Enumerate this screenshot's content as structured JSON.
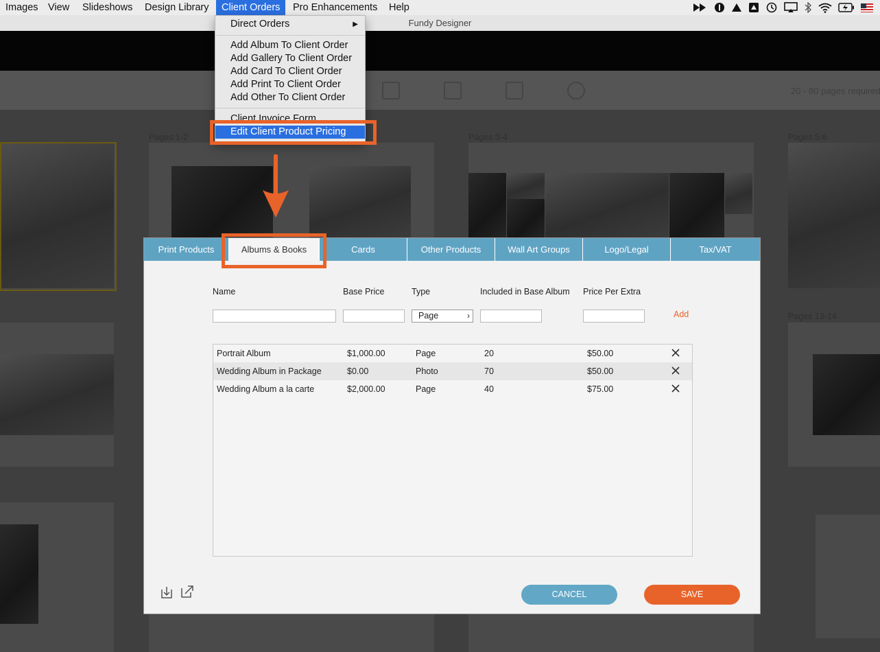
{
  "menubar": {
    "items": [
      "Images",
      "View",
      "Slideshows",
      "Design Library",
      "Client Orders",
      "Pro Enhancements",
      "Help"
    ],
    "active_index": 4
  },
  "app": {
    "title": "Fundy Designer"
  },
  "toolbar": {
    "pages_note": "20 - 80 pages required"
  },
  "spreads": {
    "labels": [
      "Pages 1-2",
      "Pages 3-4",
      "Pages 5-6",
      "Pages 13-14"
    ]
  },
  "client_orders_menu": {
    "direct_orders": "Direct Orders",
    "add_album": "Add Album To Client Order",
    "add_gallery": "Add Gallery To Client Order",
    "add_card": "Add Card To Client Order",
    "add_print": "Add Print To Client Order",
    "add_other": "Add Other To Client Order",
    "invoice_form": "Client Invoice Form",
    "edit_pricing": "Edit Client Product Pricing"
  },
  "dialog": {
    "tabs": [
      "Print Products",
      "Albums & Books",
      "Cards",
      "Other Products",
      "Wall Art Groups",
      "Logo/Legal",
      "Tax/VAT"
    ],
    "active_tab": 1,
    "columns": {
      "name": "Name",
      "base_price": "Base Price",
      "type": "Type",
      "included": "Included in Base Album",
      "price_per_extra": "Price Per Extra"
    },
    "new_entry": {
      "name": "",
      "base_price": "",
      "type": "Page",
      "included": "",
      "price_per_extra": ""
    },
    "add_label": "Add",
    "rows": [
      {
        "name": "Portrait Album",
        "base_price": "$1,000.00",
        "type": "Page",
        "included": "20",
        "price_per_extra": "$50.00"
      },
      {
        "name": "Wedding Album in Package",
        "base_price": "$0.00",
        "type": "Photo",
        "included": "70",
        "price_per_extra": "$50.00"
      },
      {
        "name": "Wedding Album a la carte",
        "base_price": "$2,000.00",
        "type": "Page",
        "included": "40",
        "price_per_extra": "$75.00"
      }
    ],
    "cancel_label": "CANCEL",
    "save_label": "SAVE"
  },
  "colors": {
    "accent_orange": "#e8632a",
    "tab_blue": "#5fa3c3",
    "menu_highlight": "#2a6fe0"
  }
}
